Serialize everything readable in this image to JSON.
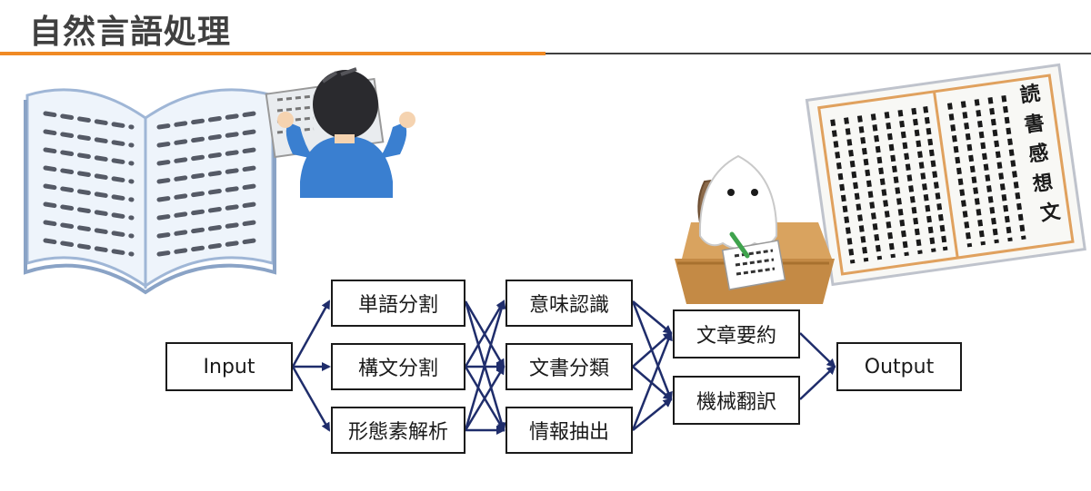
{
  "title": "自然言語処理",
  "colors": {
    "accent_orange": "#f08a24",
    "rule_dark": "#404040",
    "arrow_navy": "#1f2d6b",
    "box_border": "#1a1a1a"
  },
  "illustrations": {
    "open_book": "open-book-illustration",
    "reader": "person-reading-newspaper-illustration",
    "ghost_writer": "ghost-writing-at-desk-illustration",
    "essay_paper": "book-report-paper-illustration",
    "essay_paper_title": "読書感想文"
  },
  "flow": {
    "input": "Input",
    "output": "Output",
    "stage1": [
      "単語分割",
      "構文分割",
      "形態素解析"
    ],
    "stage2": [
      "意味認識",
      "文書分類",
      "情報抽出"
    ],
    "stage3": [
      "文章要約",
      "機械翻訳"
    ]
  }
}
